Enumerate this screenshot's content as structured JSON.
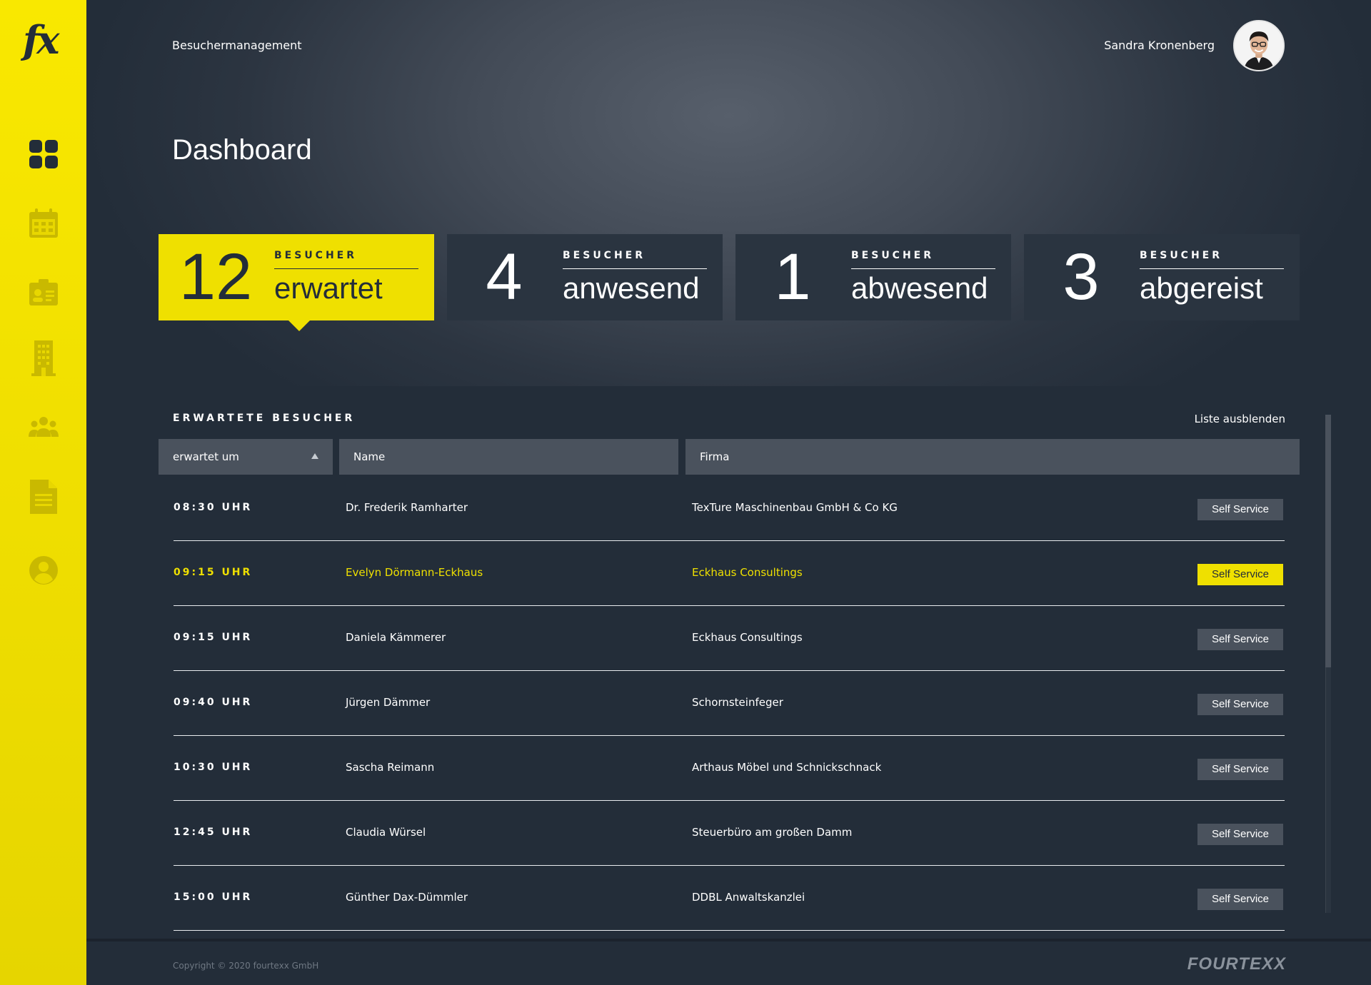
{
  "app": {
    "logo": "fx",
    "breadcrumb": "Besuchermanagement",
    "user_name": "Sandra Kronenberg"
  },
  "sidebar": {
    "items": [
      {
        "icon": "dashboard-icon"
      },
      {
        "icon": "calendar-icon"
      },
      {
        "icon": "id-card-icon"
      },
      {
        "icon": "building-icon"
      },
      {
        "icon": "people-group-icon"
      },
      {
        "icon": "document-icon"
      },
      {
        "icon": "user-icon"
      }
    ]
  },
  "page": {
    "title": "Dashboard"
  },
  "stats": [
    {
      "number": "12",
      "label_small": "BESUCHER",
      "label_big": "erwartet"
    },
    {
      "number": "4",
      "label_small": "BESUCHER",
      "label_big": "anwesend"
    },
    {
      "number": "1",
      "label_small": "BESUCHER",
      "label_big": "abwesend"
    },
    {
      "number": "3",
      "label_small": "BESUCHER",
      "label_big": "abgereist"
    }
  ],
  "visitors": {
    "title": "ERWARTETE BESUCHER",
    "hide_label": "Liste ausblenden",
    "columns": [
      "erwartet um",
      "Name",
      "Firma"
    ],
    "rows": [
      {
        "time": "08:30 UHR",
        "name": "Dr. Frederik Ramharter",
        "firm": "TexTure Maschinenbau GmbH & Co KG",
        "action": "Self Service"
      },
      {
        "time": "09:15 UHR",
        "name": "Evelyn Dörmann-Eckhaus",
        "firm": "Eckhaus Consultings",
        "action": "Self Service"
      },
      {
        "time": "09:15 UHR",
        "name": "Daniela Kämmerer",
        "firm": "Eckhaus Consultings",
        "action": "Self Service"
      },
      {
        "time": "09:40 UHR",
        "name": "Jürgen Dämmer",
        "firm": "Schornsteinfeger",
        "action": "Self Service"
      },
      {
        "time": "10:30 UHR",
        "name": "Sascha Reimann",
        "firm": "Arthaus Möbel und Schnickschnack",
        "action": "Self Service"
      },
      {
        "time": "12:45 UHR",
        "name": "Claudia Würsel",
        "firm": "Steuerbüro am großen Damm",
        "action": "Self Service"
      },
      {
        "time": "15:00 UHR",
        "name": "Günther Dax-Dümmler",
        "firm": "DDBL Anwaltskanzlei",
        "action": "Self Service"
      }
    ]
  },
  "footer": {
    "copyright": "Copyright © 2020 fourtexx GmbH",
    "brand": "FOURTEXX"
  },
  "colors": {
    "accent": "#efe000",
    "background": "#232d39",
    "card": "#2a3440",
    "header_cell": "#4a525d"
  }
}
